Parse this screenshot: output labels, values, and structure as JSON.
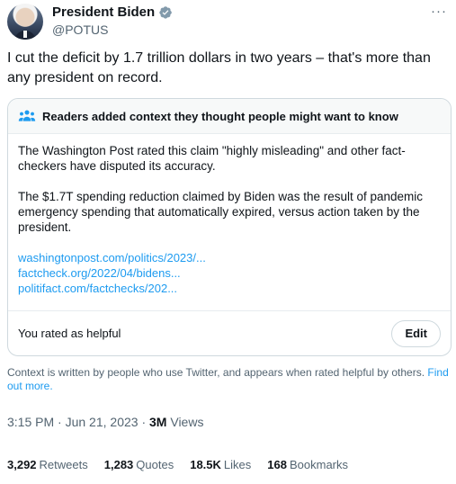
{
  "author": {
    "display_name": "President Biden",
    "handle": "@POTUS",
    "verified_color": "#829aab",
    "avatar_icon": "avatar-photo"
  },
  "more_label": "···",
  "tweet": {
    "text": "I cut the deficit by 1.7 trillion dollars in two years – that's more than any president on record."
  },
  "note": {
    "icon": "people-icon",
    "title": "Readers added context they thought people might want to know",
    "paragraphs": [
      "The Washington Post rated this claim \"highly misleading\" and other fact-checkers have disputed its accuracy.",
      "The $1.7T spending reduction claimed by Biden was the result of pandemic emergency spending that automatically expired, versus action taken by the president."
    ],
    "links": [
      "washingtonpost.com/politics/2023/...",
      "factcheck.org/2022/04/bidens...",
      "politifact.com/factchecks/202..."
    ],
    "rated_text": "You rated as helpful",
    "edit_label": "Edit"
  },
  "disclaimer": {
    "text": "Context is written by people who use Twitter, and appears when rated helpful by others.",
    "link": "Find out more."
  },
  "meta": {
    "time": "3:15 PM",
    "date": "Jun 21, 2023",
    "views_count": "3M",
    "views_label": "Views"
  },
  "stats": [
    {
      "count": "3,292",
      "label": "Retweets"
    },
    {
      "count": "1,283",
      "label": "Quotes"
    },
    {
      "count": "18.5K",
      "label": "Likes"
    },
    {
      "count": "168",
      "label": "Bookmarks"
    }
  ],
  "colors": {
    "link": "#1d9bf0",
    "secondary_text": "#536471",
    "border": "#cfd9de"
  }
}
